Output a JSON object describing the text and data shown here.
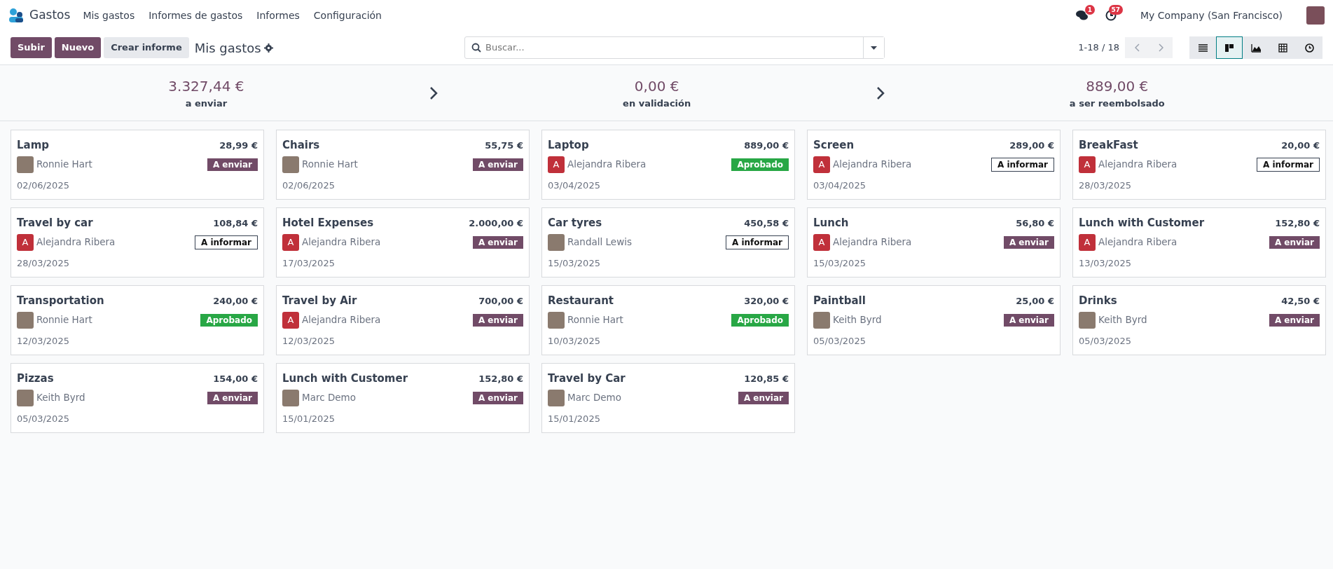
{
  "app": {
    "name": "Gastos"
  },
  "menu": [
    "Mis gastos",
    "Informes de gastos",
    "Informes",
    "Configuración"
  ],
  "systray": {
    "messages_count": "1",
    "activities_count": "57",
    "company": "My Company (San Francisco)"
  },
  "control_panel": {
    "buttons": [
      {
        "label": "Subir",
        "kind": "primary"
      },
      {
        "label": "Nuevo",
        "kind": "primary"
      },
      {
        "label": "Crear informe",
        "kind": "secondary"
      }
    ],
    "breadcrumb": "Mis gastos",
    "search": {
      "placeholder": "Buscar..."
    },
    "pager": "1-18 / 18",
    "views": [
      {
        "kind": "list",
        "selected": false
      },
      {
        "kind": "kanban",
        "selected": true
      },
      {
        "kind": "graph",
        "selected": false
      },
      {
        "kind": "pivot",
        "selected": false
      },
      {
        "kind": "activity",
        "selected": false
      }
    ]
  },
  "summary": [
    {
      "amount": "3.327,44 €",
      "label": "a enviar"
    },
    {
      "amount": "0,00 €",
      "label": "en validación"
    },
    {
      "amount": "889,00 €",
      "label": "a ser reembolsado"
    }
  ],
  "cards": [
    {
      "title": "Lamp",
      "amount": "28,99 €",
      "employee": "Ronnie Hart",
      "avatar": {
        "kind": "photo"
      },
      "status": {
        "label": "A enviar",
        "kind": "to_submit"
      },
      "date": "02/06/2025"
    },
    {
      "title": "Chairs",
      "amount": "55,75 €",
      "employee": "Ronnie Hart",
      "avatar": {
        "kind": "photo"
      },
      "status": {
        "label": "A enviar",
        "kind": "to_submit"
      },
      "date": "02/06/2025"
    },
    {
      "title": "Laptop",
      "amount": "889,00 €",
      "employee": "Alejandra Ribera",
      "avatar": {
        "kind": "letter",
        "initial": "A"
      },
      "status": {
        "label": "Aprobado",
        "kind": "approved"
      },
      "date": "03/04/2025"
    },
    {
      "title": "Screen",
      "amount": "289,00 €",
      "employee": "Alejandra Ribera",
      "avatar": {
        "kind": "letter",
        "initial": "A"
      },
      "status": {
        "label": "A informar",
        "kind": "to_report"
      },
      "date": "03/04/2025"
    },
    {
      "title": "BreakFast",
      "amount": "20,00 €",
      "employee": "Alejandra Ribera",
      "avatar": {
        "kind": "letter",
        "initial": "A"
      },
      "status": {
        "label": "A informar",
        "kind": "to_report"
      },
      "date": "28/03/2025"
    },
    {
      "title": "Travel by car",
      "amount": "108,84 €",
      "employee": "Alejandra Ribera",
      "avatar": {
        "kind": "letter",
        "initial": "A"
      },
      "status": {
        "label": "A informar",
        "kind": "to_report"
      },
      "date": "28/03/2025"
    },
    {
      "title": "Hotel Expenses",
      "amount": "2.000,00 €",
      "employee": "Alejandra Ribera",
      "avatar": {
        "kind": "letter",
        "initial": "A"
      },
      "status": {
        "label": "A enviar",
        "kind": "to_submit"
      },
      "date": "17/03/2025"
    },
    {
      "title": "Car tyres",
      "amount": "450,58 €",
      "employee": "Randall Lewis",
      "avatar": {
        "kind": "photo"
      },
      "status": {
        "label": "A informar",
        "kind": "to_report"
      },
      "date": "15/03/2025"
    },
    {
      "title": "Lunch",
      "amount": "56,80 €",
      "employee": "Alejandra Ribera",
      "avatar": {
        "kind": "letter",
        "initial": "A"
      },
      "status": {
        "label": "A enviar",
        "kind": "to_submit"
      },
      "date": "15/03/2025"
    },
    {
      "title": "Lunch with Customer",
      "amount": "152,80 €",
      "employee": "Alejandra Ribera",
      "avatar": {
        "kind": "letter",
        "initial": "A"
      },
      "status": {
        "label": "A enviar",
        "kind": "to_submit"
      },
      "date": "13/03/2025"
    },
    {
      "title": "Transportation",
      "amount": "240,00 €",
      "employee": "Ronnie Hart",
      "avatar": {
        "kind": "photo"
      },
      "status": {
        "label": "Aprobado",
        "kind": "approved"
      },
      "date": "12/03/2025"
    },
    {
      "title": "Travel by Air",
      "amount": "700,00 €",
      "employee": "Alejandra Ribera",
      "avatar": {
        "kind": "letter",
        "initial": "A"
      },
      "status": {
        "label": "A enviar",
        "kind": "to_submit"
      },
      "date": "12/03/2025"
    },
    {
      "title": "Restaurant",
      "amount": "320,00 €",
      "employee": "Ronnie Hart",
      "avatar": {
        "kind": "photo"
      },
      "status": {
        "label": "Aprobado",
        "kind": "approved"
      },
      "date": "10/03/2025"
    },
    {
      "title": "Paintball",
      "amount": "25,00 €",
      "employee": "Keith Byrd",
      "avatar": {
        "kind": "photo"
      },
      "status": {
        "label": "A enviar",
        "kind": "to_submit"
      },
      "date": "05/03/2025"
    },
    {
      "title": "Drinks",
      "amount": "42,50 €",
      "employee": "Keith Byrd",
      "avatar": {
        "kind": "photo"
      },
      "status": {
        "label": "A enviar",
        "kind": "to_submit"
      },
      "date": "05/03/2025"
    },
    {
      "title": "Pizzas",
      "amount": "154,00 €",
      "employee": "Keith Byrd",
      "avatar": {
        "kind": "photo"
      },
      "status": {
        "label": "A enviar",
        "kind": "to_submit"
      },
      "date": "05/03/2025"
    },
    {
      "title": "Lunch with Customer",
      "amount": "152,80 €",
      "employee": "Marc Demo",
      "avatar": {
        "kind": "photo"
      },
      "status": {
        "label": "A enviar",
        "kind": "to_submit"
      },
      "date": "15/01/2025"
    },
    {
      "title": "Travel by Car",
      "amount": "120,85 €",
      "employee": "Marc Demo",
      "avatar": {
        "kind": "photo"
      },
      "status": {
        "label": "A enviar",
        "kind": "to_submit"
      },
      "date": "15/01/2025"
    }
  ]
}
